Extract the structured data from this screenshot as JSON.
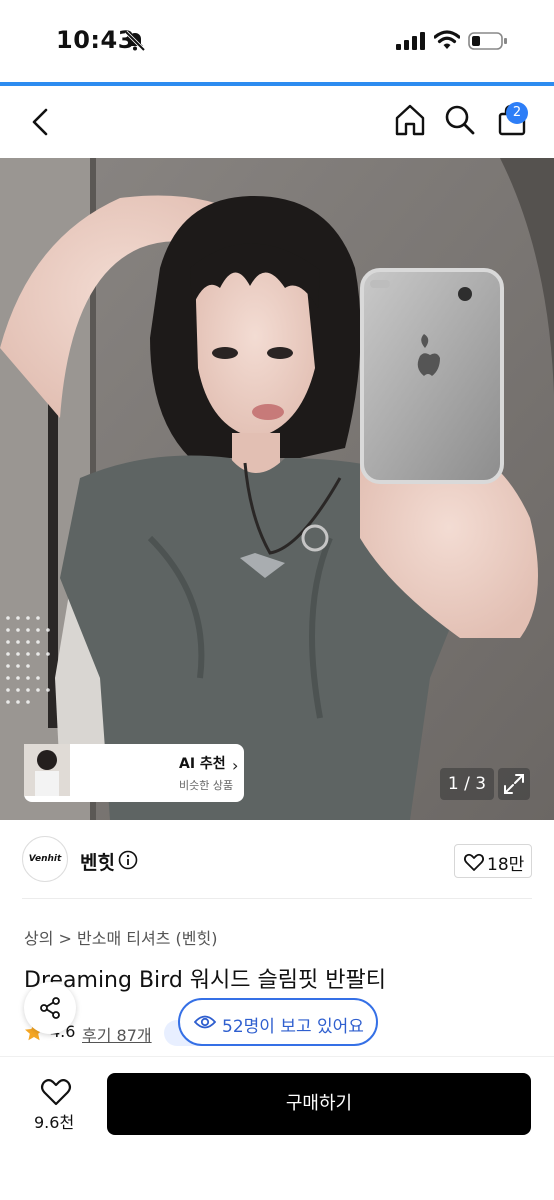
{
  "status_bar": {
    "time": "10:43"
  },
  "nav": {
    "cart_count": "2"
  },
  "hero": {
    "ai_title": "AI 추천",
    "ai_subtitle": "비슷한 상품",
    "pager": "1 / 3"
  },
  "brand": {
    "logo_text": "Venhit",
    "name": "벤힛",
    "like_count": "18만"
  },
  "product": {
    "breadcrumb": "상의 > 반소매 티셔츠 (벤힛)",
    "title": "Dreaming Bird 워시드 슬림핏 반팔티",
    "rating": "4.6",
    "reviews": "후기 87개"
  },
  "viewing": {
    "text": "52명이 보고 있어요"
  },
  "bottom": {
    "wish_count": "9.6천",
    "buy_label": "구매하기"
  },
  "colors": {
    "accent_blue": "#2d7ef7",
    "buy_button": "#000000",
    "star": "#f5a623"
  }
}
